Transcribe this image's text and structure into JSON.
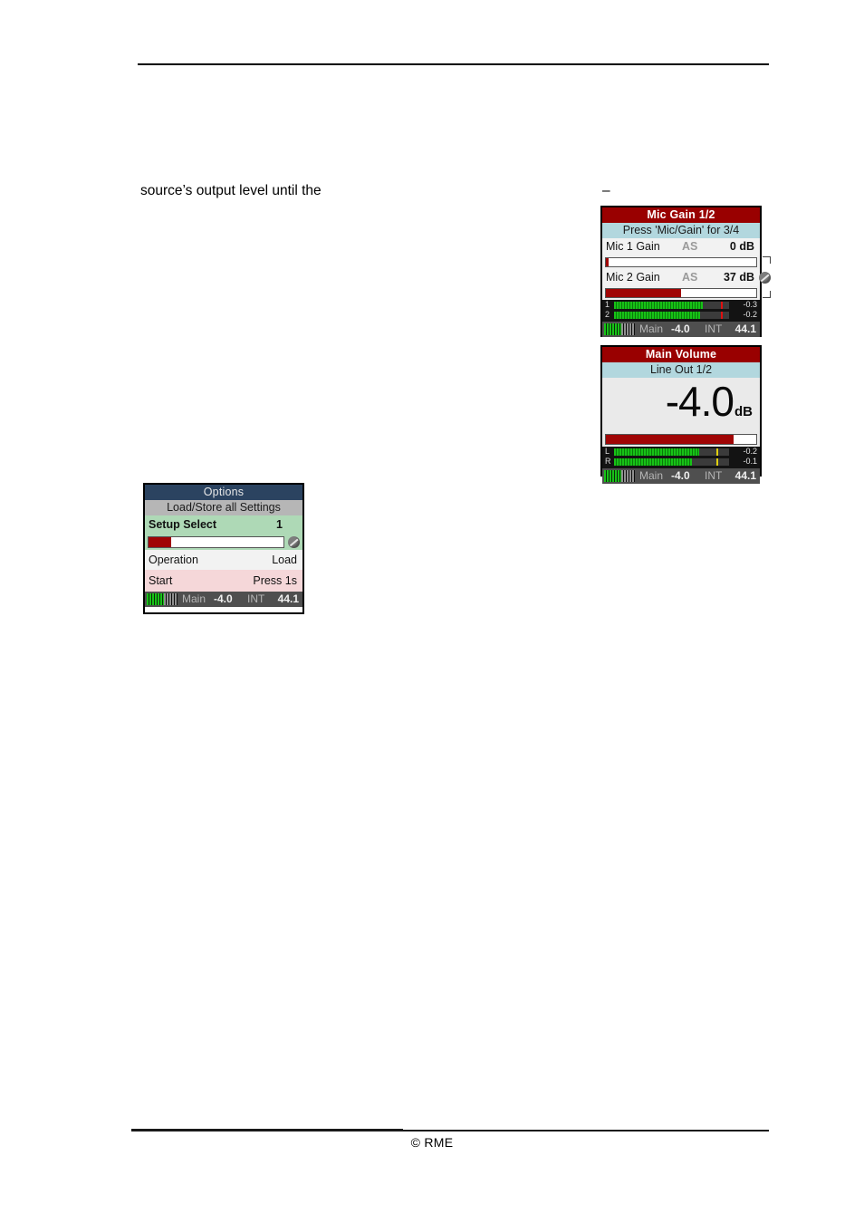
{
  "page": {
    "body_text": "source’s output level until the",
    "loose_dash": "–",
    "footer_copyright": "© RME"
  },
  "panels": {
    "mic_gain": {
      "title": "Mic Gain 1/2",
      "subtitle": "Press 'Mic/Gain' for 3/4",
      "rows": [
        {
          "label": "Mic 1 Gain",
          "mid": "AS",
          "value": "0 dB",
          "fill_pct": 2
        },
        {
          "label": "Mic 2 Gain",
          "mid": "AS",
          "value": "37 dB",
          "fill_pct": 50
        }
      ],
      "meters": [
        {
          "id": "1",
          "fill_pct": 77,
          "peak_pct": 93,
          "peak_color": "red",
          "value": "-0.3"
        },
        {
          "id": "2",
          "fill_pct": 75,
          "peak_pct": 93,
          "peak_color": "red",
          "value": "-0.2"
        }
      ],
      "status": {
        "meter_fill_pct": 55,
        "main_label": "Main",
        "main_value": "-4.0",
        "clock_label": "INT",
        "sample_rate": "44.1"
      }
    },
    "main_volume": {
      "title": "Main Volume",
      "subtitle": "Line Out 1/2",
      "readout_value": "-4.0",
      "readout_unit": "dB",
      "readout_fill_pct": 85,
      "meters": [
        {
          "id": "L",
          "fill_pct": 74,
          "peak_pct": 89,
          "peak_color": "yellow",
          "value": "-0.2"
        },
        {
          "id": "R",
          "fill_pct": 68,
          "peak_pct": 89,
          "peak_color": "yellow",
          "value": "-0.1"
        }
      ],
      "status": {
        "meter_fill_pct": 55,
        "main_label": "Main",
        "main_value": "-4.0",
        "clock_label": "INT",
        "sample_rate": "44.1"
      }
    },
    "options": {
      "title": "Options",
      "subtitle": "Load/Store all Settings",
      "setup_select": {
        "label": "Setup Select",
        "value": "1",
        "fill_pct": 17
      },
      "operation": {
        "label": "Operation",
        "value": "Load"
      },
      "start": {
        "label": "Start",
        "value": "Press 1s"
      },
      "status": {
        "meter_fill_pct": 55,
        "main_label": "Main",
        "main_value": "-4.0",
        "clock_label": "INT",
        "sample_rate": "44.1"
      }
    }
  },
  "colors": {
    "title_red": "#990000",
    "title_navy": "#2b4360",
    "subtitle_cyan": "#b2d7de",
    "subtitle_gray": "#b6b6b6",
    "row_green": "#aed9b6",
    "row_pink": "#f5d7d9",
    "slider_red": "#a00505",
    "meter_green": "#17c217",
    "statusbar_gray": "#4f4f4f"
  }
}
